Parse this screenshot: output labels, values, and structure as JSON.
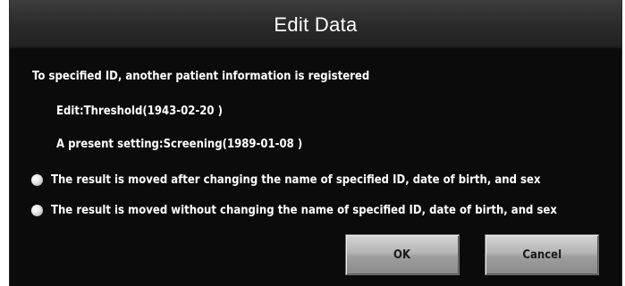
{
  "dialog": {
    "title": "Edit Data",
    "message": "To specified ID, another patient information is registered",
    "edit_line": "Edit:Threshold(1943-02-20 )",
    "present_line": "A present setting:Screening(1989-01-08 )",
    "options": [
      {
        "label": "The result is moved after changing the name of specified ID, date of birth, and sex"
      },
      {
        "label": "The result is moved without changing the name of specified ID, date of birth, and sex"
      }
    ],
    "ok_label": "OK",
    "cancel_label": "Cancel"
  },
  "colors": {
    "background": "#0b0b0b",
    "titlebar": "#2e2e2e",
    "text": "#ffffff",
    "button": "#b4b4b4"
  }
}
